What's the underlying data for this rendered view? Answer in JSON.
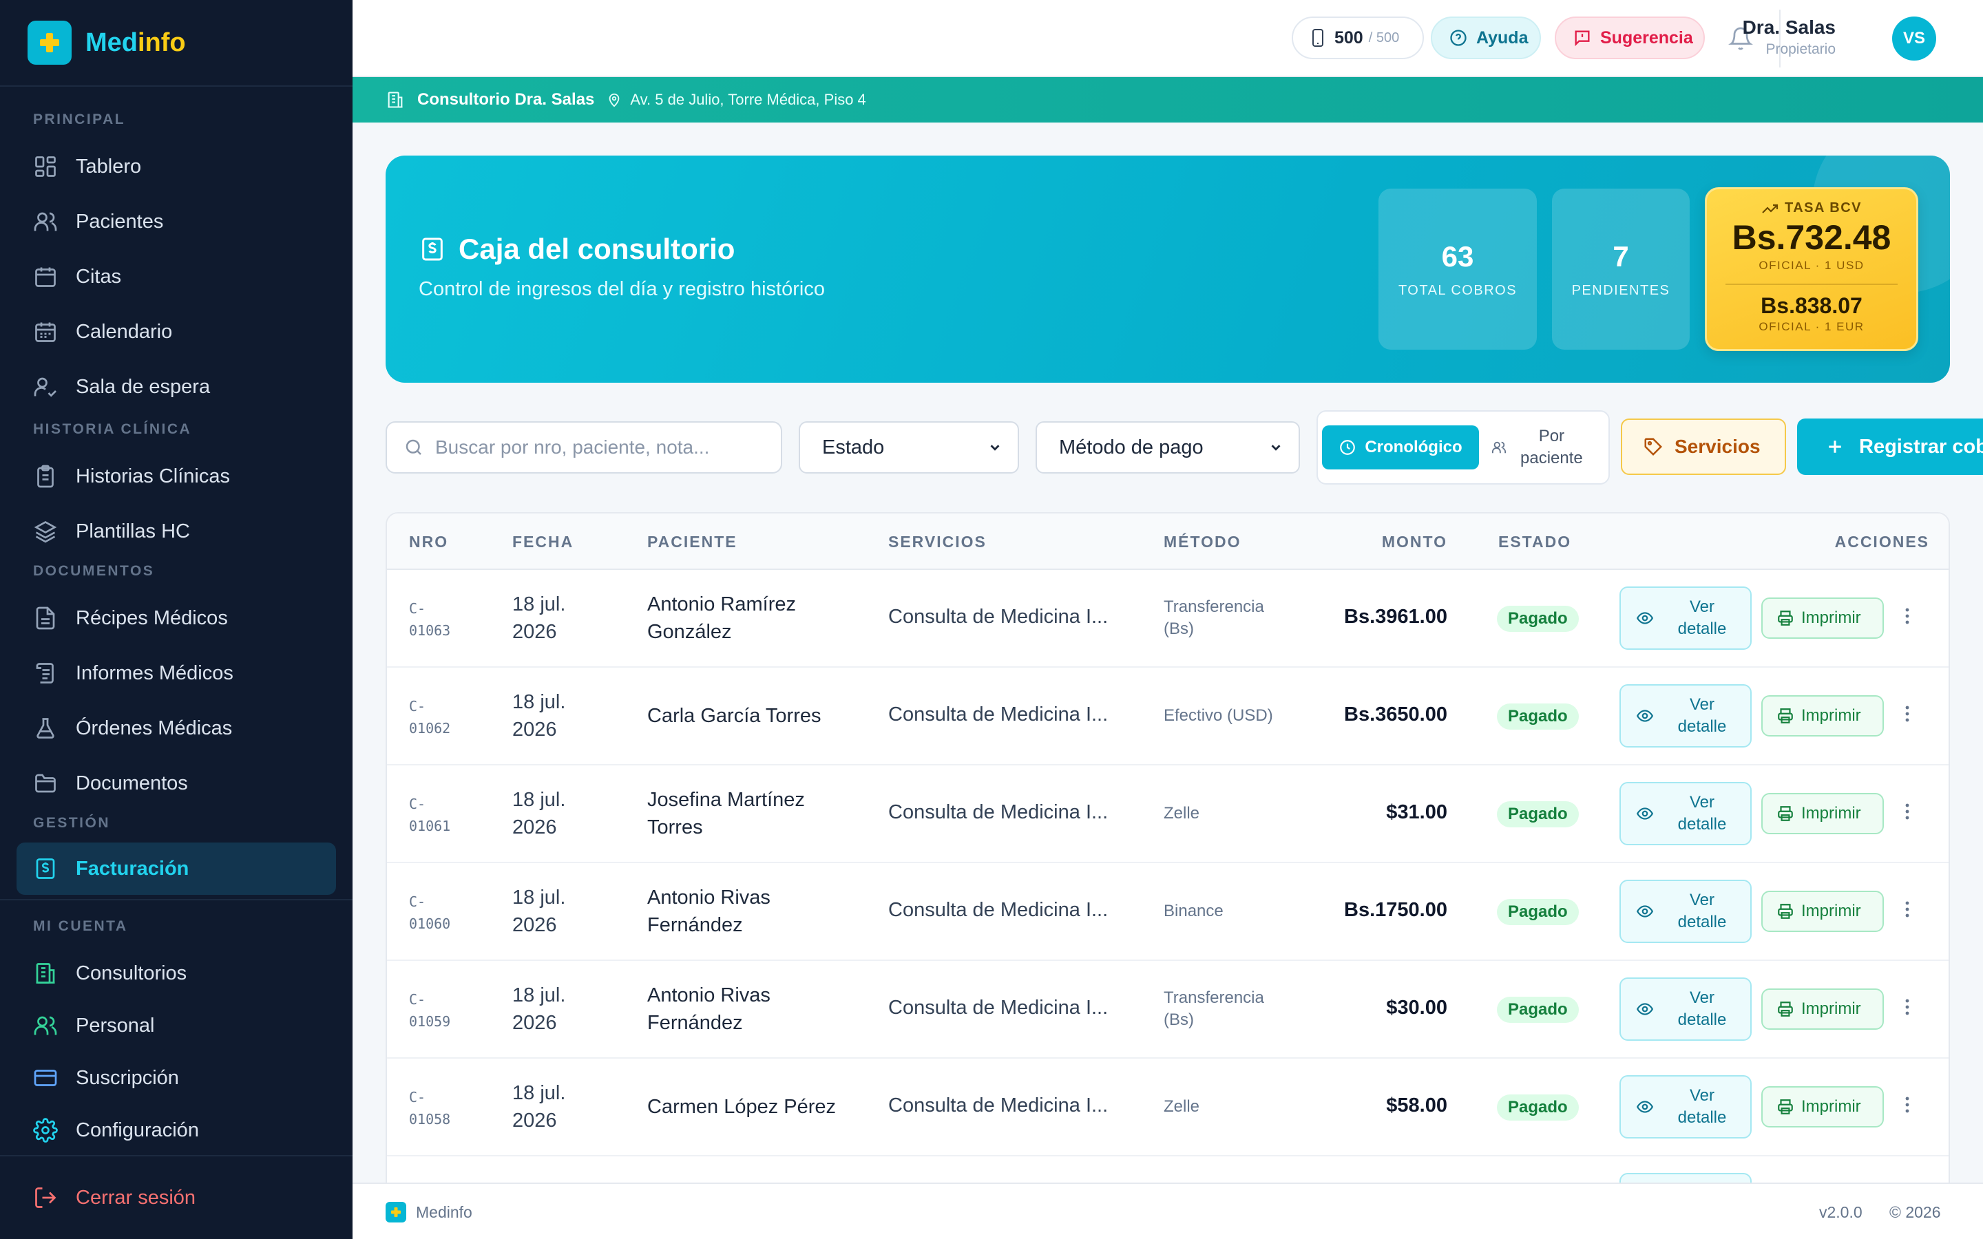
{
  "brand": {
    "name_part1": "Med",
    "name_part2": "info"
  },
  "sidebar": {
    "sections": {
      "principal": "PRINCIPAL",
      "historia": "HISTORIA CLÍNICA",
      "documentos": "DOCUMENTOS",
      "gestion": "GESTIÓN",
      "cuenta": "MI CUENTA"
    },
    "items": {
      "tablero": "Tablero",
      "pacientes": "Pacientes",
      "citas": "Citas",
      "calendario": "Calendario",
      "sala": "Sala de espera",
      "historias": "Historias Clínicas",
      "plantillas": "Plantillas HC",
      "recipes": "Récipes Médicos",
      "informes": "Informes Médicos",
      "ordenes": "Órdenes Médicas",
      "documentos": "Documentos",
      "facturacion": "Facturación",
      "consultorios": "Consultorios",
      "personal": "Personal",
      "suscripcion": "Suscripción",
      "configuracion": "Configuración",
      "logout": "Cerrar sesión"
    },
    "active_item": "facturacion"
  },
  "topbar": {
    "quota_value": "500",
    "quota_total": "/ 500",
    "help_label": "Ayuda",
    "suggest_label": "Sugerencia",
    "user_name": "Dra. Salas",
    "user_role": "Propietario",
    "user_initials": "VS"
  },
  "clinic": {
    "name": "Consultorio Dra. Salas",
    "address": "Av. 5 de Julio, Torre Médica, Piso 4"
  },
  "hero": {
    "title": "Caja del consultorio",
    "subtitle": "Control de ingresos del día y registro histórico",
    "total_cobros": "63",
    "total_cobros_label": "TOTAL COBROS",
    "pendientes": "7",
    "pendientes_label": "PENDIENTES",
    "rate_title": "TASA BCV",
    "rate_usd": "Bs.732.48",
    "rate_usd_caption": "OFICIAL · 1 USD",
    "rate_eur": "Bs.838.07",
    "rate_eur_caption": "OFICIAL · 1 EUR"
  },
  "filters": {
    "search_placeholder": "Buscar por nro, paciente, nota...",
    "search_value": "",
    "estado_selected": "Estado",
    "metodo_selected": "Método de pago",
    "view_chrono": "Cronológico",
    "view_patient_line1": "Por",
    "view_patient_line2": "paciente",
    "services_label": "Servicios",
    "register_label": "Registrar cobro"
  },
  "table": {
    "headers": {
      "nro": "NRO",
      "fecha": "FECHA",
      "paciente": "PACIENTE",
      "servicios": "SERVICIOS",
      "metodo": "MÉTODO",
      "monto": "MONTO",
      "estado": "ESTADO",
      "acciones": "ACCIONES"
    },
    "view_label_1": "Ver",
    "view_label_2": "detalle",
    "print_label": "Imprimir",
    "rows": [
      {
        "nro_a": "C-",
        "nro_b": "01063",
        "fecha_a": "18 jul.",
        "fecha_b": "2026",
        "pac_a": "Antonio Ramírez",
        "pac_b": "González",
        "servicio": "Consulta de Medicina I...",
        "met_a": "Transferencia",
        "met_b": "(Bs)",
        "monto": "Bs.3961.00",
        "estado": "Pagado"
      },
      {
        "nro_a": "C-",
        "nro_b": "01062",
        "fecha_a": "18 jul.",
        "fecha_b": "2026",
        "pac_a": "Carla García Torres",
        "pac_b": "",
        "servicio": "Consulta de Medicina I...",
        "met_a": "Efectivo (USD)",
        "met_b": "",
        "monto": "Bs.3650.00",
        "estado": "Pagado"
      },
      {
        "nro_a": "C-",
        "nro_b": "01061",
        "fecha_a": "18 jul.",
        "fecha_b": "2026",
        "pac_a": "Josefina Martínez",
        "pac_b": "Torres",
        "servicio": "Consulta de Medicina I...",
        "met_a": "Zelle",
        "met_b": "",
        "monto": "$31.00",
        "estado": "Pagado"
      },
      {
        "nro_a": "C-",
        "nro_b": "01060",
        "fecha_a": "18 jul.",
        "fecha_b": "2026",
        "pac_a": "Antonio Rivas",
        "pac_b": "Fernández",
        "servicio": "Consulta de Medicina I...",
        "met_a": "Binance",
        "met_b": "",
        "monto": "Bs.1750.00",
        "estado": "Pagado"
      },
      {
        "nro_a": "C-",
        "nro_b": "01059",
        "fecha_a": "18 jul.",
        "fecha_b": "2026",
        "pac_a": "Antonio Rivas",
        "pac_b": "Fernández",
        "servicio": "Consulta de Medicina I...",
        "met_a": "Transferencia",
        "met_b": "(Bs)",
        "monto": "$30.00",
        "estado": "Pagado"
      },
      {
        "nro_a": "C-",
        "nro_b": "01058",
        "fecha_a": "18 jul.",
        "fecha_b": "2026",
        "pac_a": "Carmen López Pérez",
        "pac_b": "",
        "servicio": "Consulta de Medicina I...",
        "met_a": "Zelle",
        "met_b": "",
        "monto": "$58.00",
        "estado": "Pagado"
      }
    ]
  },
  "footer": {
    "app": "Medinfo",
    "version": "v2.0.0",
    "copyright": "© 2026"
  },
  "colors": {
    "accent": "#06b6d4",
    "sidebar_bg": "#0f1a2e",
    "clinic_strip": "#14b8a6",
    "rate_card": "#fbbf24",
    "status_paid": "#15803d",
    "danger": "#f87171"
  }
}
